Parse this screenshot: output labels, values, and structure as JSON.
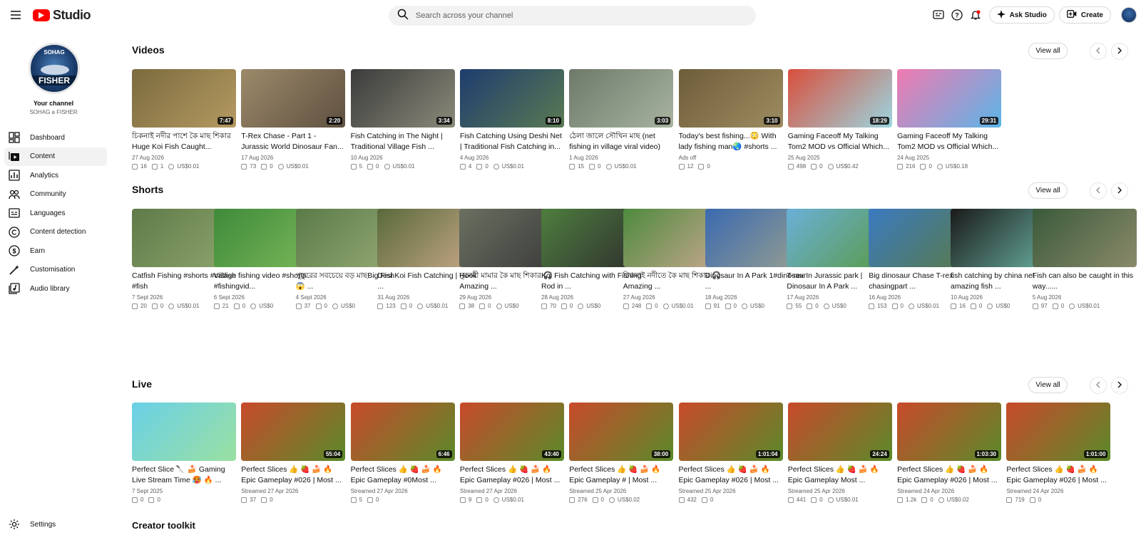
{
  "header": {
    "logo_text": "Studio",
    "search_placeholder": "Search across your channel",
    "ask_studio": "Ask Studio",
    "create": "Create",
    "icons": [
      "subtitles-icon",
      "help-icon",
      "notifications-icon"
    ],
    "accent": "#ff0000"
  },
  "channel": {
    "avatar_top": "SOHAG",
    "avatar_bottom": "FISHER",
    "label": "Your channel",
    "name": "SOHAG a FISHER"
  },
  "nav": [
    {
      "label": "Dashboard",
      "icon": "dashboard-icon",
      "active": false
    },
    {
      "label": "Content",
      "icon": "content-icon",
      "active": true
    },
    {
      "label": "Analytics",
      "icon": "analytics-icon",
      "active": false
    },
    {
      "label": "Community",
      "icon": "community-icon",
      "active": false
    },
    {
      "label": "Languages",
      "icon": "languages-icon",
      "active": false
    },
    {
      "label": "Content detection",
      "icon": "copyright-icon",
      "active": false
    },
    {
      "label": "Earn",
      "icon": "earn-icon",
      "active": false
    },
    {
      "label": "Customisation",
      "icon": "customisation-icon",
      "active": false
    },
    {
      "label": "Audio library",
      "icon": "audio-library-icon",
      "active": false
    }
  ],
  "settings_label": "Settings",
  "view_all": "View all",
  "sections": {
    "videos": {
      "title": "Videos",
      "items": [
        {
          "title": "চিকনাই নদীর পাশে কৈ মাছ শিকার Huge Koi Fish Caught...",
          "date": "27 Aug 2026",
          "views": "16",
          "comments": "1",
          "revenue": "US$0.01",
          "duration": "7:47",
          "colors": [
            "#7a6a3d",
            "#b59a62"
          ]
        },
        {
          "title": "T-Rex Chase - Part 1 - Jurassic World Dinosaur Fan...",
          "date": "17 Aug 2026",
          "views": "73",
          "comments": "0",
          "revenue": "US$0.01",
          "duration": "2:20",
          "colors": [
            "#9c8a6a",
            "#5f5040"
          ]
        },
        {
          "title": "Fish Catching in The Night | Traditional Village Fish ...",
          "date": "10 Aug 2026",
          "views": "5",
          "comments": "0",
          "revenue": "US$0.01",
          "duration": "3:34",
          "colors": [
            "#3b3b3b",
            "#8a8a7a"
          ]
        },
        {
          "title": "Fish Catching Using Deshi Net | Traditional Fish Catching in...",
          "date": "4 Aug 2026",
          "views": "4",
          "comments": "0",
          "revenue": "US$0.01",
          "duration": "8:10",
          "colors": [
            "#1e3c6e",
            "#5a7a52"
          ]
        },
        {
          "title": "ঠেলা জালে সৌখিন মাছ (net fishing in village viral video)",
          "date": "1 Aug 2026",
          "views": "15",
          "comments": "0",
          "revenue": "US$0.01",
          "duration": "3:03",
          "colors": [
            "#6d7a6a",
            "#a8b4a0"
          ]
        },
        {
          "title": "Today's best fishing...😳 With lady fishing man🌏 #shorts ...",
          "date": "Ads off",
          "views": "12",
          "comments": "0",
          "revenue": "",
          "duration": "3:10",
          "colors": [
            "#6e5d3a",
            "#9e8c60"
          ]
        },
        {
          "title": "Gaming Faceoff My Talking Tom2 MOD vs Official Which...",
          "date": "25 Aug 2025",
          "views": "498",
          "comments": "0",
          "revenue": "US$0.42",
          "duration": "18:29",
          "colors": [
            "#d94f3d",
            "#9bd6e0"
          ]
        },
        {
          "title": "Gaming Faceoff My Talking Tom2 MOD vs Official Which...",
          "date": "24 Aug 2025",
          "views": "216",
          "comments": "0",
          "revenue": "US$0.18",
          "duration": "29:31",
          "colors": [
            "#f07ab0",
            "#5bb5e8"
          ]
        }
      ]
    },
    "shorts": {
      "title": "Shorts",
      "items": [
        {
          "title": "Catfish Fishing #shorts #catfish #fish",
          "date": "7 Sept 2026",
          "views": "20",
          "comments": "0",
          "revenue": "US$0.01",
          "colors": [
            "#5f7a48",
            "#8ea56e"
          ]
        },
        {
          "title": "Village fishing video #shorts #fishingvid...",
          "date": "6 Sept 2026",
          "views": "21",
          "comments": "0",
          "revenue": "US$0",
          "colors": [
            "#3f8a3a",
            "#7ab85a"
          ]
        },
        {
          "title": "পুকুরের সবচেয়ে বড় মাছBig Fish😱 ...",
          "date": "4 Sept 2026",
          "views": "37",
          "comments": "0",
          "revenue": "US$0",
          "colors": [
            "#5a7a48",
            "#95aa75"
          ]
        },
        {
          "title": "Desi Koi Fish Catching | Hook ...",
          "date": "31 Aug 2026",
          "views": "123",
          "comments": "0",
          "revenue": "US$0.01",
          "colors": [
            "#5a6a3a",
            "#c8a88a"
          ]
        },
        {
          "title": "নুরনবী মামার কৈ মাছ শিকার 🎧 Amazing ...",
          "date": "29 Aug 2026",
          "views": "38",
          "comments": "0",
          "revenue": "US$0",
          "colors": [
            "#6a7060",
            "#3a3a3a"
          ]
        },
        {
          "title": "Koi Fish Catching with Fishing Rod in ...",
          "date": "28 Aug 2026",
          "views": "70",
          "comments": "0",
          "revenue": "US$0",
          "colors": [
            "#4e7e3e",
            "#2e2e2e"
          ]
        },
        {
          "title": "চিকনাই নদীতে কৈ মাছ শিকার 🎧 Amazing ...",
          "date": "27 Aug 2026",
          "views": "248",
          "comments": "0",
          "revenue": "US$0.01",
          "colors": [
            "#4e8a3e",
            "#c9a890"
          ]
        },
        {
          "title": "Dinosaur In A Park 1#dinosaur ...",
          "date": "18 Aug 2026",
          "views": "91",
          "comments": "0",
          "revenue": "US$0",
          "colors": [
            "#3a6ab0",
            "#9aa090"
          ]
        },
        {
          "title": "T-rex In Jurassic park | Dinosaur In A Park ...",
          "date": "17 Aug 2026",
          "views": "55",
          "comments": "0",
          "revenue": "US$0",
          "colors": [
            "#6ab0d8",
            "#5a9a48"
          ]
        },
        {
          "title": "Big dinosaur Chase T-rex chasingpart ...",
          "date": "16 Aug 2026",
          "views": "153",
          "comments": "0",
          "revenue": "US$0.01",
          "colors": [
            "#3a7ac0",
            "#5a7a48"
          ]
        },
        {
          "title": "fish catching by china net amazing fish ...",
          "date": "10 Aug 2026",
          "views": "16",
          "comments": "0",
          "revenue": "US$0",
          "colors": [
            "#1a1a1a",
            "#6ab0a0"
          ]
        },
        {
          "title": "Fish can also be caught in this way......",
          "date": "5 Aug 2026",
          "views": "97",
          "comments": "0",
          "revenue": "US$0.01",
          "colors": [
            "#3a5a3a",
            "#8a8a6a"
          ]
        }
      ]
    },
    "live": {
      "title": "Live",
      "items": [
        {
          "title": "Perfect Slice 🔪 🍰 Gaming Live Stream Time 🥵 🔥 ...",
          "date": "7 Sept 2025",
          "views": "0",
          "comments": "0",
          "revenue": "",
          "duration": "",
          "colors": [
            "#6ad0e8",
            "#9ae0a0"
          ]
        },
        {
          "title": "Perfect Slices 👍 🍓 🍰 🔥 Epic Gameplay #026 | Most ...",
          "date": "Streamed 27 Apr 2026",
          "views": "37",
          "comments": "0",
          "revenue": "",
          "duration": "55:04",
          "colors": [
            "#c84a2a",
            "#5a8a2a"
          ]
        },
        {
          "title": "Perfect Slices 👍 🍓 🍰 🔥 Epic Gameplay #0Most ...",
          "date": "Streamed 27 Apr 2026",
          "views": "5",
          "comments": "0",
          "revenue": "",
          "duration": "6:46",
          "colors": [
            "#c84a2a",
            "#5a8a2a"
          ]
        },
        {
          "title": "Perfect Slices 👍 🍓 🍰 🔥 Epic Gameplay #026 | Most ...",
          "date": "Streamed 27 Apr 2026",
          "views": "9",
          "comments": "0",
          "revenue": "US$0.01",
          "duration": "43:40",
          "colors": [
            "#c84a2a",
            "#5a8a2a"
          ]
        },
        {
          "title": "Perfect Slices 👍 🍓 🍰 🔥 Epic Gameplay # | Most ...",
          "date": "Streamed 25 Apr 2026",
          "views": "276",
          "comments": "0",
          "revenue": "US$0.02",
          "duration": "38:00",
          "colors": [
            "#c84a2a",
            "#5a8a2a"
          ]
        },
        {
          "title": "Perfect Slices 👍 🍓 🍰 🔥 Epic Gameplay #026 | Most ...",
          "date": "Streamed 25 Apr 2026",
          "views": "432",
          "comments": "0",
          "revenue": "",
          "duration": "1:01:04",
          "colors": [
            "#c84a2a",
            "#5a8a2a"
          ]
        },
        {
          "title": "Perfect Slices 👍 🍓 🍰 🔥 Epic Gameplay Most ...",
          "date": "Streamed 25 Apr 2026",
          "views": "441",
          "comments": "0",
          "revenue": "US$0.01",
          "duration": "24:24",
          "colors": [
            "#c84a2a",
            "#5a8a2a"
          ]
        },
        {
          "title": "Perfect Slices 👍 🍓 🍰 🔥 Epic Gameplay #026 | Most ...",
          "date": "Streamed 24 Apr 2026",
          "views": "1.2k",
          "comments": "0",
          "revenue": "US$0.02",
          "duration": "1:03:30",
          "colors": [
            "#c84a2a",
            "#5a8a2a"
          ]
        },
        {
          "title": "Perfect Slices 👍 🍓 🍰 🔥 Epic Gameplay #026 | Most ...",
          "date": "Streamed 24 Apr 2026",
          "views": "719",
          "comments": "0",
          "revenue": "",
          "duration": "1:01:00",
          "colors": [
            "#c84a2a",
            "#5a8a2a"
          ]
        }
      ]
    }
  },
  "creator_toolkit": "Creator toolkit"
}
